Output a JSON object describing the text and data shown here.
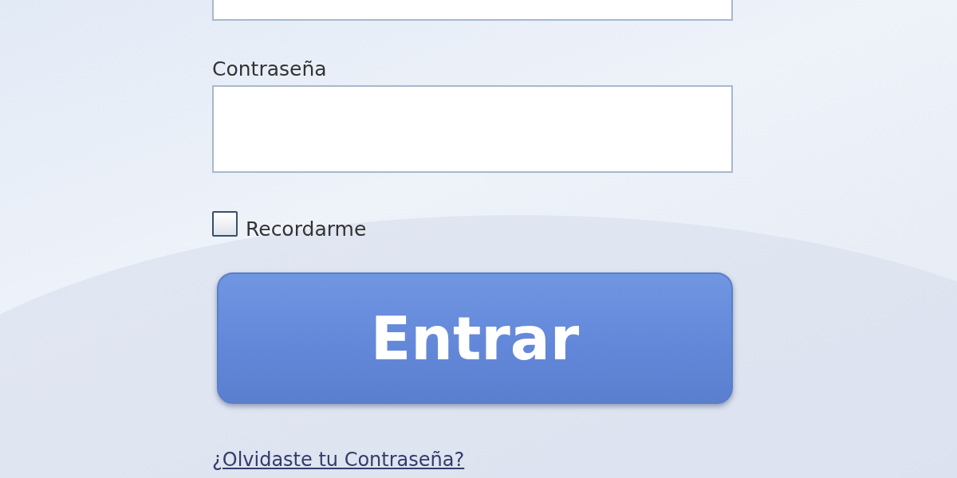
{
  "password": {
    "label": "Contraseña"
  },
  "remember": {
    "label": "Recordarme",
    "checked": false
  },
  "submit": {
    "label": "Entrar"
  },
  "forgot_link": {
    "label": "¿Olvidaste tu Contraseña?"
  }
}
